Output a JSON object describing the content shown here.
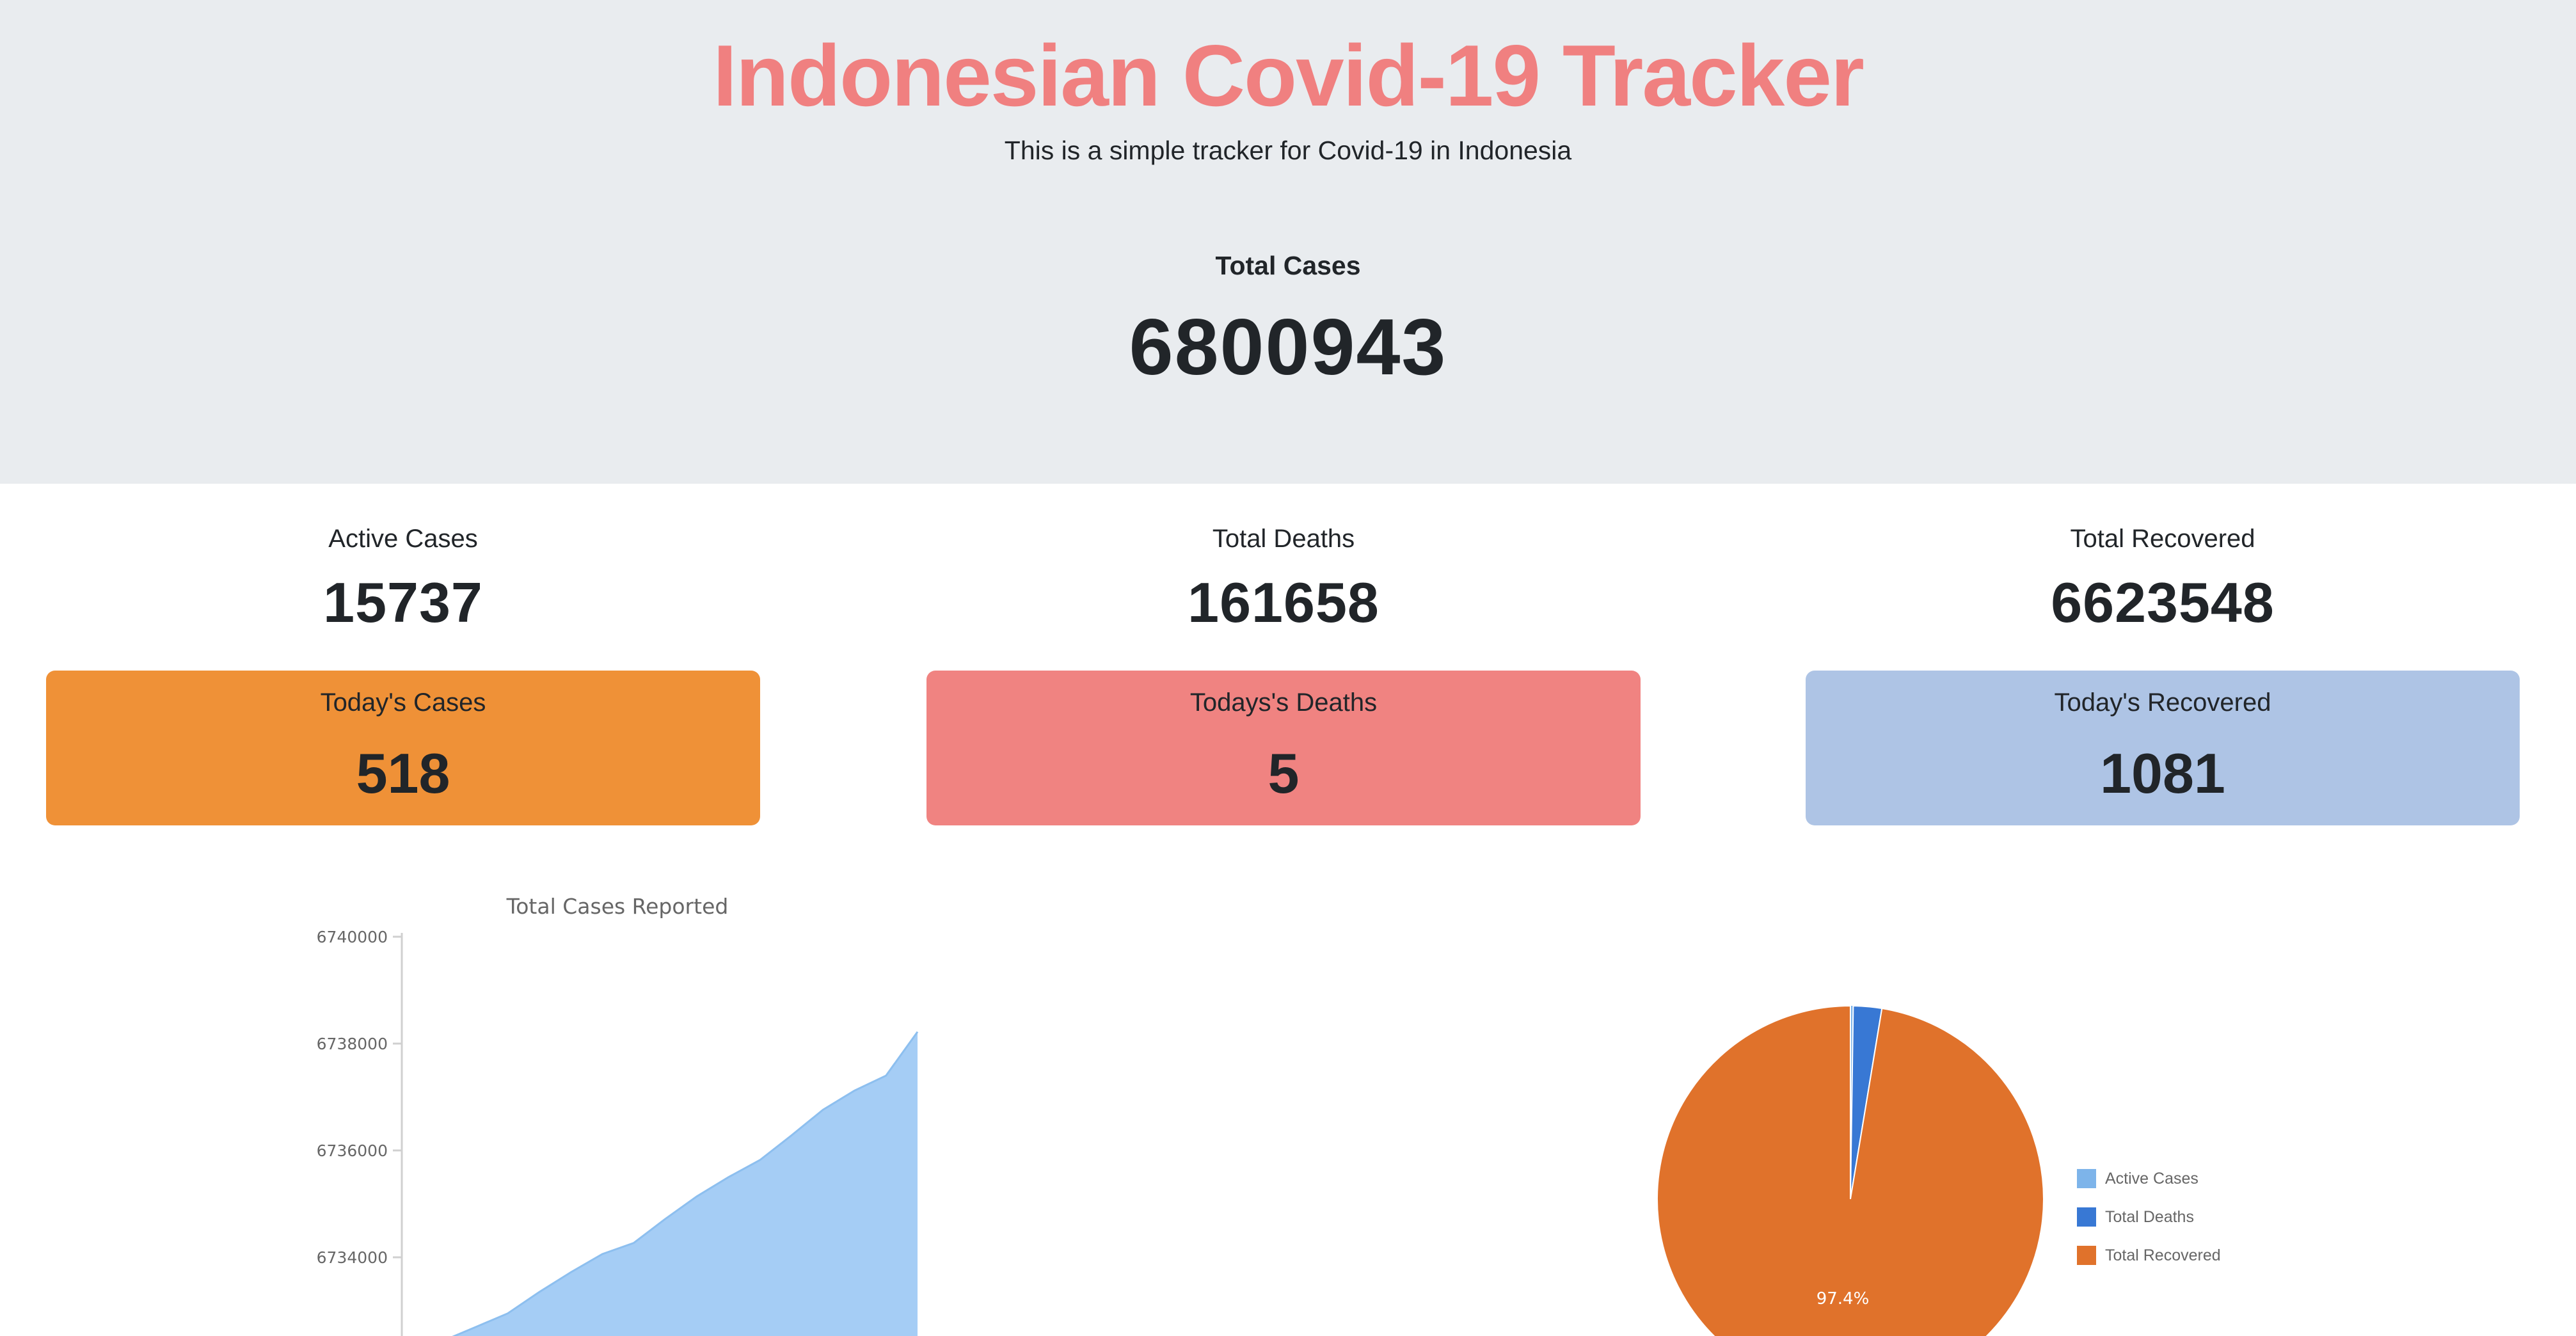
{
  "header": {
    "title": "Indonesian Covid-19 Tracker",
    "subtitle": "This is a simple tracker for Covid-19 in Indonesia",
    "total_label": "Total Cases",
    "total_value": "6800943"
  },
  "stats": [
    {
      "label": "Active Cases",
      "value": "15737"
    },
    {
      "label": "Total Deaths",
      "value": "161658"
    },
    {
      "label": "Total Recovered",
      "value": "6623548"
    }
  ],
  "today": [
    {
      "label": "Today's Cases",
      "value": "518",
      "color": "#ef9137"
    },
    {
      "label": "Todays's Deaths",
      "value": "5",
      "color": "#f08381"
    },
    {
      "label": "Today's Recovered",
      "value": "1081",
      "color": "#aec4e5"
    }
  ],
  "colors": {
    "title": "#f08080",
    "area_fill": "#a5cdf5",
    "area_stroke": "#8dbfef",
    "pie_active": "#7db4ea",
    "pie_deaths": "#3878d4",
    "pie_recovered": "#e0722b"
  },
  "chart_data": [
    {
      "type": "area",
      "title": "Total Cases Reported",
      "xlabel": "",
      "ylabel": "",
      "ylim": [
        6732000,
        6740000
      ],
      "yticks": [
        6740000,
        6738000,
        6736000,
        6734000
      ],
      "grid": false,
      "values": [
        6732450,
        6732700,
        6732950,
        6733350,
        6733720,
        6734060,
        6734270,
        6734720,
        6735140,
        6735500,
        6735820,
        6736280,
        6736760,
        6737120,
        6737400,
        6738220
      ]
    },
    {
      "type": "pie",
      "labels": [
        "Active Cases",
        "Total Deaths",
        "Total Recovered"
      ],
      "values": [
        15737,
        161658,
        6623548
      ],
      "data_labels": [
        "97.4%"
      ],
      "legend": "right"
    }
  ]
}
